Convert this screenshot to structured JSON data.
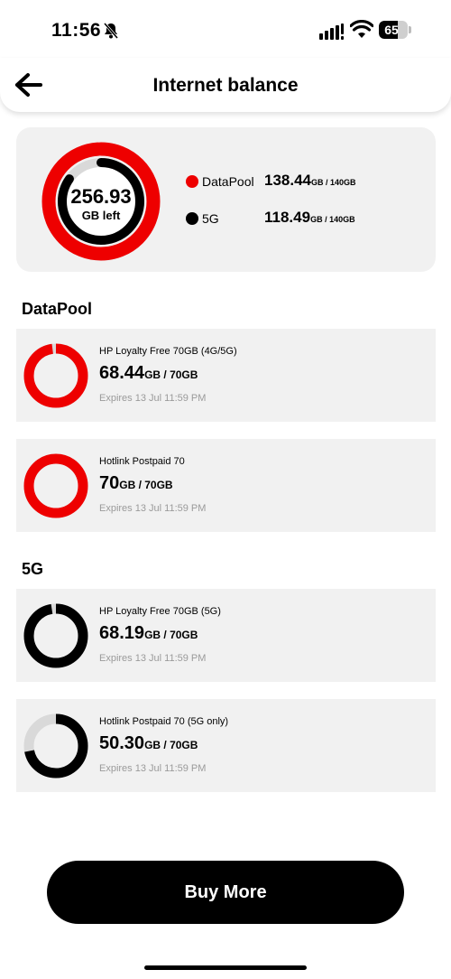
{
  "status_bar": {
    "time": "11:56",
    "battery_level": "65",
    "battery_fraction": 0.65
  },
  "header": {
    "title": "Internet balance",
    "back_icon": "arrow-left-icon"
  },
  "summary": {
    "total_value": "256.93",
    "total_unit": "GB left",
    "ring_colors": {
      "outer": "#ee0000",
      "inner": "#000000",
      "track": "#d9d9d9"
    },
    "datapool_fraction": 0.989,
    "fiveg_fraction": 0.847,
    "legend": [
      {
        "label": "DataPool",
        "amount": "138.44",
        "suffix": "GB / 140GB",
        "color": "#ee0000"
      },
      {
        "label": "5G",
        "amount": "118.49",
        "suffix": "GB / 140GB",
        "color": "#000000"
      }
    ]
  },
  "sections": [
    {
      "title": "DataPool",
      "plans": [
        {
          "name": "HP Loyalty Free 70GB (4G/5G)",
          "amount": "68.44",
          "suffix": "GB / 70GB",
          "expiry": "Expires 13 Jul 11:59 PM",
          "fraction": 0.978,
          "color": "#ee0000"
        },
        {
          "name": "Hotlink Postpaid 70",
          "amount": "70",
          "suffix": "GB / 70GB",
          "expiry": "Expires 13 Jul 11:59 PM",
          "fraction": 1.0,
          "color": "#ee0000"
        }
      ]
    },
    {
      "title": "5G",
      "plans": [
        {
          "name": "HP Loyalty Free 70GB (5G)",
          "amount": "68.19",
          "suffix": "GB / 70GB",
          "expiry": "Expires 13 Jul 11:59 PM",
          "fraction": 0.974,
          "color": "#000000"
        },
        {
          "name": "Hotlink Postpaid 70 (5G only)",
          "amount": "50.30",
          "suffix": "GB / 70GB",
          "expiry": "Expires 13 Jul 11:59 PM",
          "fraction": 0.719,
          "color": "#000000"
        }
      ]
    }
  ],
  "buy_more_label": "Buy More"
}
